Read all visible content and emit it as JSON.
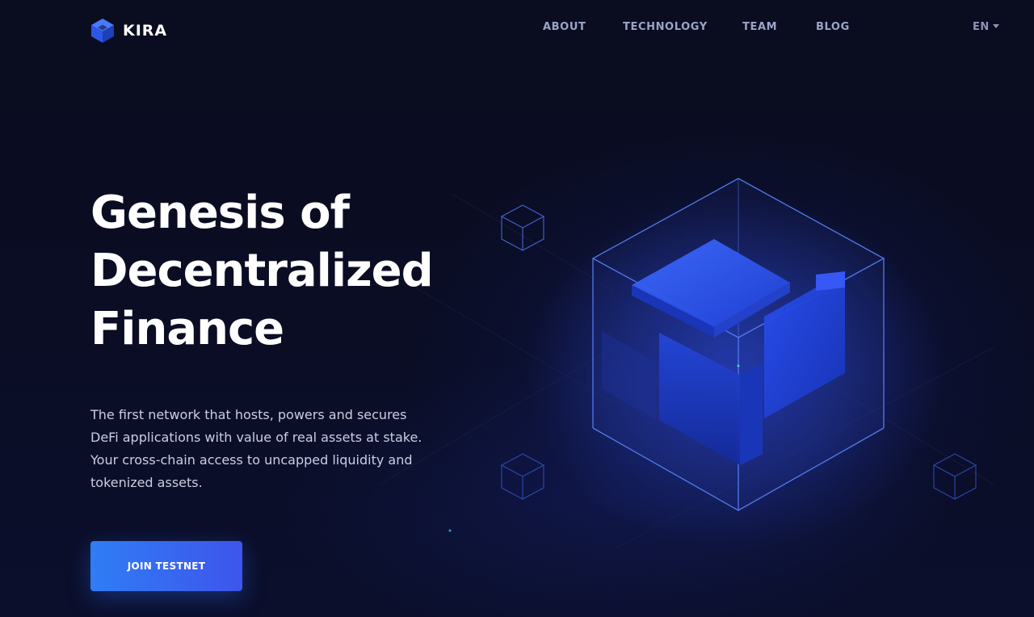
{
  "brand": {
    "name": "KIRA",
    "accent": "#3569f0"
  },
  "nav": {
    "items": [
      {
        "label": "ABOUT"
      },
      {
        "label": "TECHNOLOGY"
      },
      {
        "label": "TEAM"
      },
      {
        "label": "BLOG"
      }
    ],
    "language": "EN"
  },
  "hero": {
    "headline": [
      "Genesis of",
      "Decentralized",
      "Finance"
    ],
    "lede": "The first network that hosts, powers and secures DeFi applications with value of real assets at stake. Your cross-chain access to uncapped liquidity and tokenized assets.",
    "cta_label": "JOIN TESTNET"
  },
  "colors": {
    "background": "#0a0c1e",
    "nav_text": "#9aa6c6",
    "cta_start": "#2f7df5",
    "cta_end": "#3e55ec"
  },
  "icons": {
    "logo": "kira-cube-logo-icon",
    "language_caret": "caret-down-icon"
  }
}
